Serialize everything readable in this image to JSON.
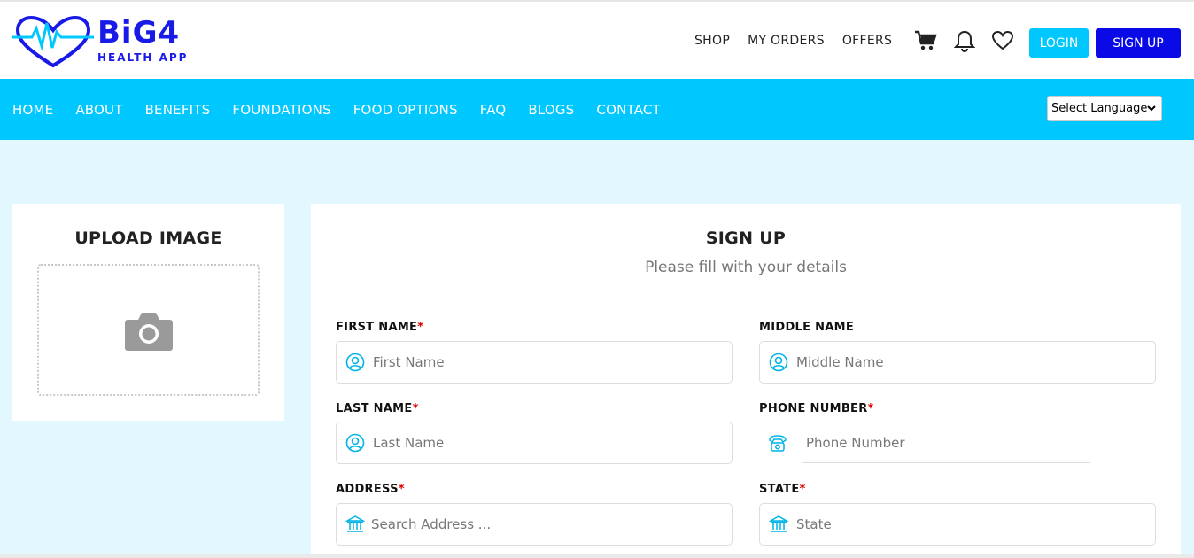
{
  "brand": {
    "name": "BiG4",
    "subtitle": "HEALTH APP"
  },
  "top_nav": {
    "links": [
      "SHOP",
      "MY ORDERS",
      "OFFERS"
    ],
    "login_label": "LOGIN",
    "signup_label": "SIGN UP"
  },
  "main_nav": {
    "links": [
      "HOME",
      "ABOUT",
      "BENEFITS",
      "FOUNDATIONS",
      "FOOD OPTIONS",
      "FAQ",
      "BLOGS",
      "CONTACT"
    ],
    "language_select": "Select Language"
  },
  "upload": {
    "title": "UPLOAD IMAGE"
  },
  "form": {
    "title": "SIGN UP",
    "subtitle": "Please fill with your details",
    "fields": {
      "first_name": {
        "label": "FIRST NAME",
        "placeholder": "First Name",
        "required": "*"
      },
      "middle_name": {
        "label": "MIDDLE NAME",
        "placeholder": "Middle Name"
      },
      "last_name": {
        "label": "LAST NAME",
        "placeholder": "Last Name",
        "required": "*"
      },
      "phone": {
        "label": "PHONE NUMBER",
        "placeholder": "Phone Number",
        "required": "*"
      },
      "address": {
        "label": "ADDRESS",
        "placeholder": "Search Address ...",
        "required": "*"
      },
      "state": {
        "label": "STATE",
        "placeholder": "State",
        "required": "*"
      }
    }
  },
  "colors": {
    "accent": "#00c8ff",
    "primary": "#0a0ae6",
    "page_bg": "#e3f8fe",
    "required": "#e00000"
  },
  "icons": [
    "heartbeat-logo-icon",
    "cart-icon",
    "bell-icon",
    "heart-icon",
    "camera-icon",
    "user-icon",
    "phone-icon",
    "bank-icon",
    "chevron-down-icon"
  ]
}
